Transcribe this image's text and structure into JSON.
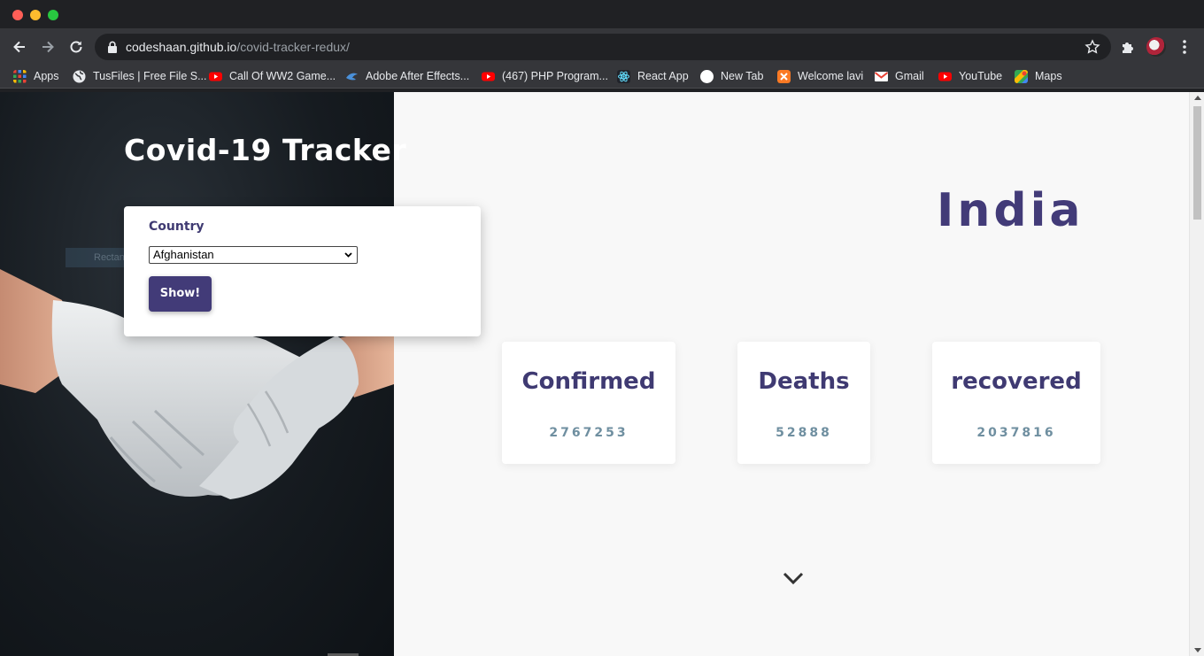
{
  "browser": {
    "url_domain": "codeshaan.github.io",
    "url_path": "/covid-tracker-redux/",
    "bookmarks": [
      {
        "label": "Apps",
        "icon": "apps-grid-icon",
        "color": "#e8453c"
      },
      {
        "label": "TusFiles | Free File S...",
        "icon": "globe-icon",
        "color": "#e8eaed"
      },
      {
        "label": "Call Of WW2 Game...",
        "icon": "youtube-icon",
        "color": "#ff0000"
      },
      {
        "label": "Adobe After Effects...",
        "icon": "bird-icon",
        "color": "#4a90d9"
      },
      {
        "label": "(467) PHP Program...",
        "icon": "youtube-icon",
        "color": "#ff0000"
      },
      {
        "label": "React App",
        "icon": "react-icon",
        "color": "#61dafb"
      },
      {
        "label": "New Tab",
        "icon": "blank-circle-icon",
        "color": "#ffffff"
      },
      {
        "label": "Welcome lavi",
        "icon": "xampp-icon",
        "color": "#fb7a24"
      },
      {
        "label": "Gmail",
        "icon": "gmail-icon",
        "color": "#ea4335"
      },
      {
        "label": "YouTube",
        "icon": "youtube-icon",
        "color": "#ff0000"
      },
      {
        "label": "Maps",
        "icon": "maps-icon",
        "color": "#34a853"
      }
    ]
  },
  "app": {
    "title": "Covid-19 Tracker",
    "country_form": {
      "label": "Country",
      "selected": "Afghanistan",
      "button_label": "Show!"
    },
    "ghost_label": "Rectangular",
    "selected_country": "India",
    "stats": [
      {
        "title": "Confirmed",
        "value": "2767253"
      },
      {
        "title": "Deaths",
        "value": "52888"
      },
      {
        "title": "recovered",
        "value": "2037816"
      }
    ]
  },
  "colors": {
    "accent": "#423b78",
    "stat_value": "#6f8fa0",
    "page_bg": "#f8f8f8"
  }
}
